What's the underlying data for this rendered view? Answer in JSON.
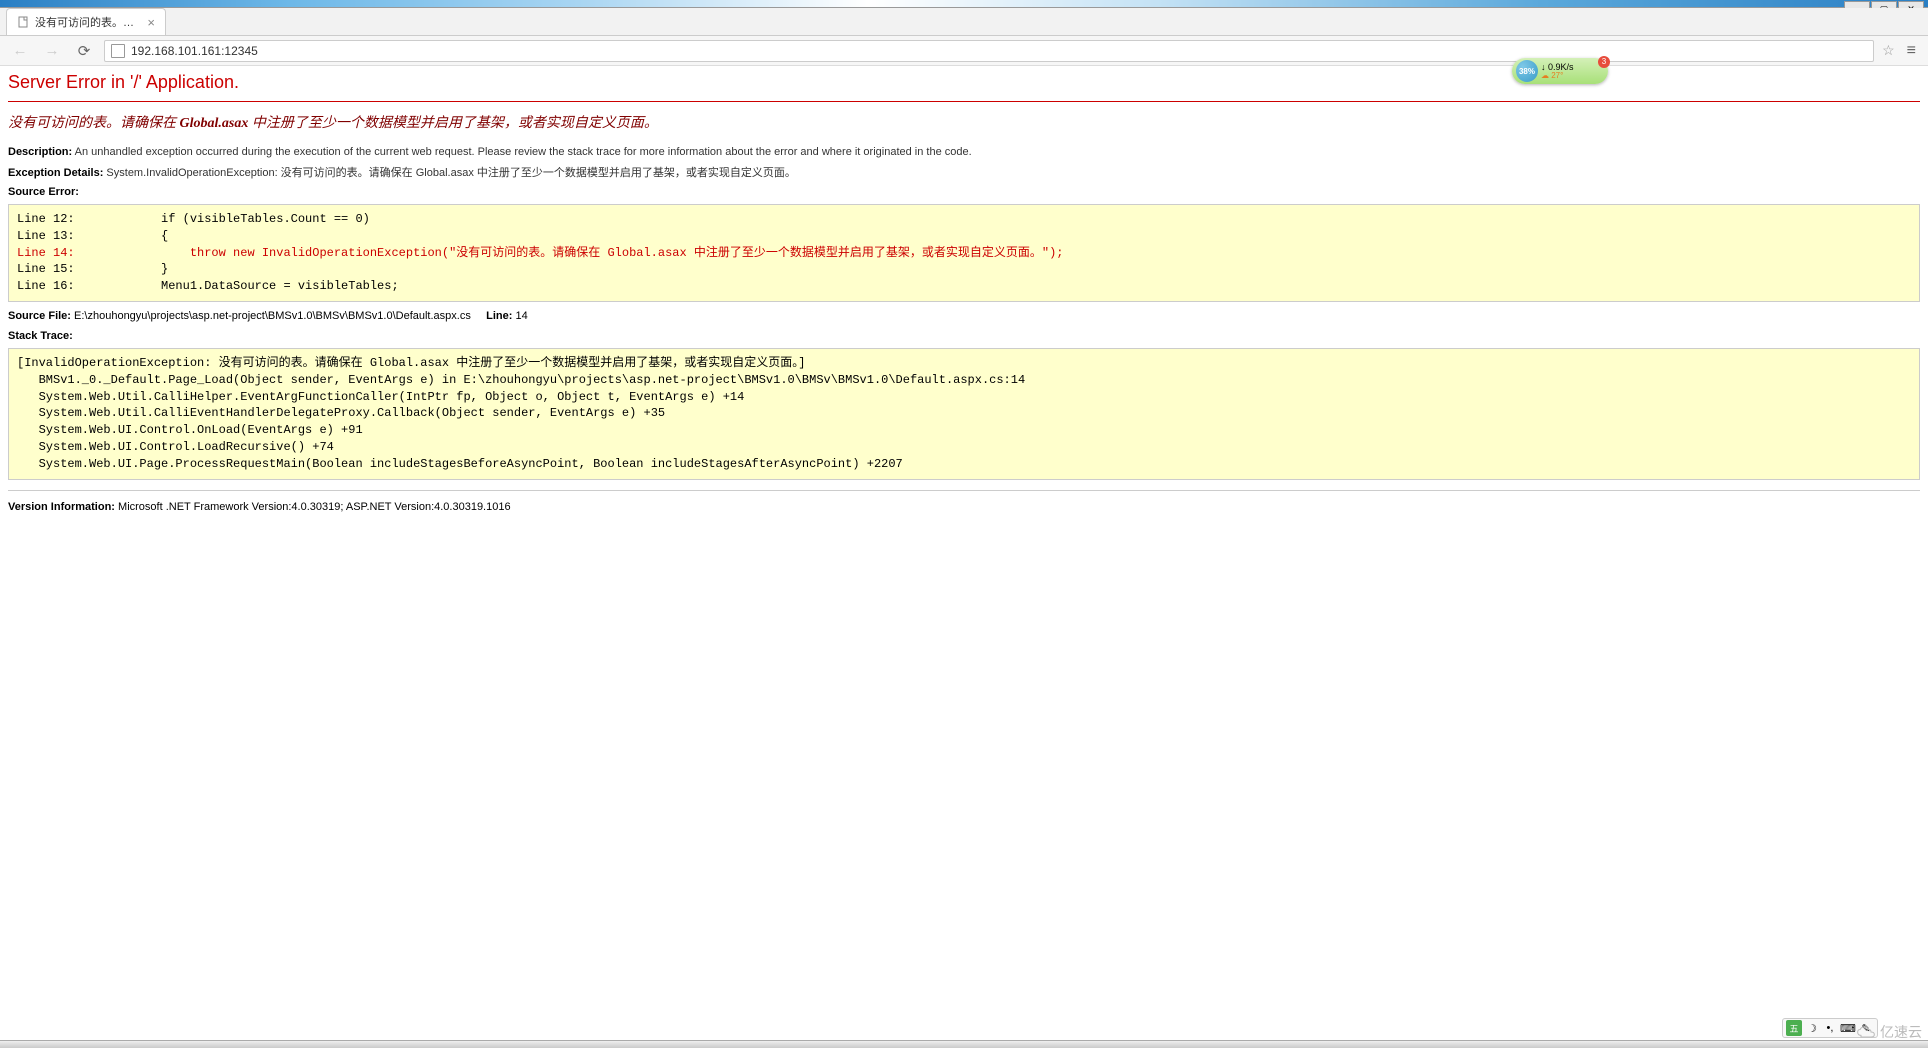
{
  "window": {
    "tab_title": "没有可访问的表。请确保..."
  },
  "address_bar": {
    "url": "192.168.101.161:12345"
  },
  "error": {
    "title": "Server Error in '/' Application.",
    "message_prefix": "没有可访问的表。请确保在 ",
    "message_bold": "Global.asax",
    "message_suffix": " 中注册了至少一个数据模型并启用了基架，或者实现自定义页面。",
    "description_label": "Description:",
    "description_text": "An unhandled exception occurred during the execution of the current web request. Please review the stack trace for more information about the error and where it originated in the code.",
    "exception_label": "Exception Details:",
    "exception_text": "System.InvalidOperationException: 没有可访问的表。请确保在 Global.asax 中注册了至少一个数据模型并启用了基架，或者实现自定义页面。",
    "source_error_label": "Source Error:",
    "source_code_pre": "Line 12:            if (visibleTables.Count == 0)\nLine 13:            {\n",
    "source_code_hl": "Line 14:                throw new InvalidOperationException(\"没有可访问的表。请确保在 Global.asax 中注册了至少一个数据模型并启用了基架，或者实现自定义页面。\");",
    "source_code_post": "\nLine 15:            }\nLine 16:            Menu1.DataSource = visibleTables;",
    "source_file_label": "Source File:",
    "source_file_text": "E:\\zhouhongyu\\projects\\asp.net-project\\BMSv1.0\\BMSv\\BMSv1.0\\Default.aspx.cs",
    "line_label": "Line:",
    "line_number": "14",
    "stack_trace_label": "Stack Trace:",
    "stack_trace_text": "[InvalidOperationException: 没有可访问的表。请确保在 Global.asax 中注册了至少一个数据模型并启用了基架，或者实现自定义页面。]\n   BMSv1._0._Default.Page_Load(Object sender, EventArgs e) in E:\\zhouhongyu\\projects\\asp.net-project\\BMSv1.0\\BMSv\\BMSv1.0\\Default.aspx.cs:14\n   System.Web.Util.CalliHelper.EventArgFunctionCaller(IntPtr fp, Object o, Object t, EventArgs e) +14\n   System.Web.Util.CalliEventHandlerDelegateProxy.Callback(Object sender, EventArgs e) +35\n   System.Web.UI.Control.OnLoad(EventArgs e) +91\n   System.Web.UI.Control.LoadRecursive() +74\n   System.Web.UI.Page.ProcessRequestMain(Boolean includeStagesBeforeAsyncPoint, Boolean includeStagesAfterAsyncPoint) +2207",
    "version_label": "Version Information:",
    "version_text": "Microsoft .NET Framework Version:4.0.30319; ASP.NET Version:4.0.30319.1016"
  },
  "widget": {
    "percent": "38%",
    "speed": "0.9K/s",
    "temp": "27°",
    "notif": "3"
  },
  "ime": {
    "label": "五"
  },
  "watermark": {
    "text": "亿速云"
  }
}
